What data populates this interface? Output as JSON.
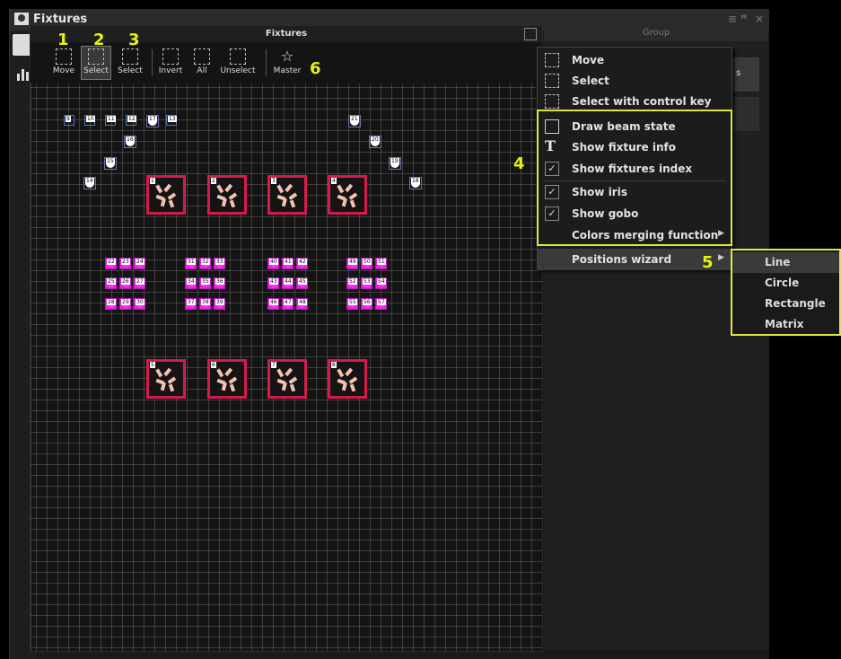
{
  "window": {
    "title": "Fixtures"
  },
  "panel": {
    "title": "Fixtures"
  },
  "right_panel": {
    "title": "Group",
    "button_label": "s"
  },
  "toolbar": [
    {
      "key": "move",
      "label": "Move"
    },
    {
      "key": "select",
      "label": "Select"
    },
    {
      "key": "select2",
      "label": "Select"
    },
    {
      "key": "invert",
      "label": "Invert"
    },
    {
      "key": "all",
      "label": "All"
    },
    {
      "key": "unselect",
      "label": "Unselect"
    },
    {
      "key": "master",
      "label": "Master"
    }
  ],
  "annotations": [
    "1",
    "2",
    "3",
    "4",
    "5",
    "6"
  ],
  "context_menu": {
    "items": [
      {
        "label": "Move",
        "icon": "move-icon"
      },
      {
        "label": "Select",
        "icon": "select-icon"
      },
      {
        "label": "Select with control key",
        "icon": "select-ctrl-icon"
      },
      {
        "label": "Draw beam state",
        "icon": "beam-icon"
      },
      {
        "label": "Show fixture info",
        "icon": "text-icon"
      },
      {
        "label": "Show fixtures index",
        "checked": true
      },
      {
        "label": "Show iris",
        "checked": true
      },
      {
        "label": "Show gobo",
        "checked": true
      },
      {
        "label": "Colors merging function",
        "submenu": true
      },
      {
        "label": "Positions wizard",
        "submenu": true
      }
    ]
  },
  "positions_wizard": [
    "Line",
    "Circle",
    "Rectangle",
    "Matrix"
  ],
  "fixtures": {
    "blue_row": [
      "9",
      "10",
      "11",
      "12",
      "17",
      "13"
    ],
    "diag_left": [
      "16",
      "15",
      "14"
    ],
    "diag_right": [
      "21",
      "20",
      "19",
      "18"
    ],
    "red_top": [
      "1",
      "2",
      "3",
      "4"
    ],
    "red_bottom": [
      "5",
      "6",
      "7",
      "8"
    ],
    "magenta": [
      [
        "22",
        "23",
        "24"
      ],
      [
        "25",
        "26",
        "27"
      ],
      [
        "28",
        "29",
        "30"
      ],
      [
        "31",
        "32",
        "33"
      ],
      [
        "34",
        "35",
        "36"
      ],
      [
        "37",
        "38",
        "39"
      ],
      [
        "40",
        "41",
        "42"
      ],
      [
        "43",
        "44",
        "45"
      ],
      [
        "46",
        "47",
        "48"
      ],
      [
        "49",
        "50",
        "51"
      ],
      [
        "52",
        "53",
        "54"
      ],
      [
        "55",
        "56",
        "57"
      ]
    ]
  },
  "colors": {
    "accent_yellow": "#e4f20f",
    "magenta": "#f01ce8",
    "red_border": "#d81a4a",
    "blue_border": "#4a7ab8"
  }
}
